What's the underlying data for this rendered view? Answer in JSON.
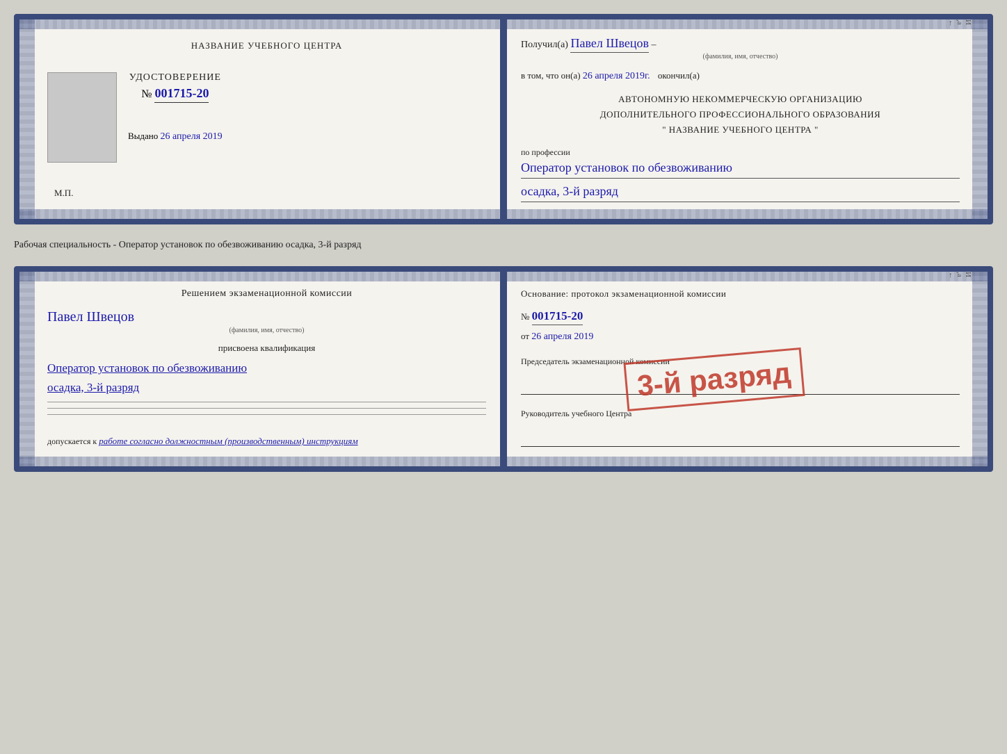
{
  "doc1": {
    "left": {
      "center_title": "НАЗВАНИЕ УЧЕБНОГО ЦЕНТРА",
      "udostoverenie_label": "УДОСТОВЕРЕНИЕ",
      "cert_number_prefix": "№",
      "cert_number": "001715-20",
      "issued_prefix": "Выдано",
      "issued_date": "26 апреля 2019",
      "mp": "М.П."
    },
    "right": {
      "recipient_prefix": "Получил(а)",
      "recipient_name": "Павел Швецов",
      "recipient_subtitle": "(фамилия, имя, отчество)",
      "dash": "–",
      "vtom_prefix": "в том, что он(а)",
      "vtom_date": "26 апреля 2019г.",
      "okonchill": "окончил(а)",
      "org_line1": "АВТОНОМНУЮ НЕКОММЕРЧЕСКУЮ ОРГАНИЗАЦИЮ",
      "org_line2": "ДОПОЛНИТЕЛЬНОГО ПРОФЕССИОНАЛЬНОГО ОБРАЗОВАНИЯ",
      "org_line3": "\" НАЗВАНИЕ УЧЕБНОГО ЦЕНТРА \"",
      "profession_label": "по профессии",
      "profession_value": "Оператор установок по обезвоживанию",
      "rank_value": "осадка, 3-й разряд"
    }
  },
  "specialty_label": "Рабочая специальность - Оператор установок по обезвоживанию осадка, 3-й разряд",
  "doc2": {
    "left": {
      "komissia_title": "Решением экзаменационной комиссии",
      "komissia_name": "Павел Швецов",
      "komissia_subtitle": "(фамилия, имя, отчество)",
      "prisvoena_label": "присвоена квалификация",
      "kvalif_value1": "Оператор установок по обезвоживанию",
      "kvalif_value2": "осадка, 3-й разряд",
      "dopusk_prefix": "допускается к",
      "dopusk_text": "работе согласно должностным (производственным) инструкциям"
    },
    "right": {
      "osnovanie_title": "Основание: протокол экзаменационной комиссии",
      "proto_prefix": "№",
      "proto_number": "001715-20",
      "ot_prefix": "от",
      "ot_date": "26 апреля 2019",
      "predsedatel_label": "Председатель экзаменационной комиссии",
      "rukovoditel_label": "Руководитель учебного Центра",
      "stamp_text": "3-й разряд"
    }
  }
}
